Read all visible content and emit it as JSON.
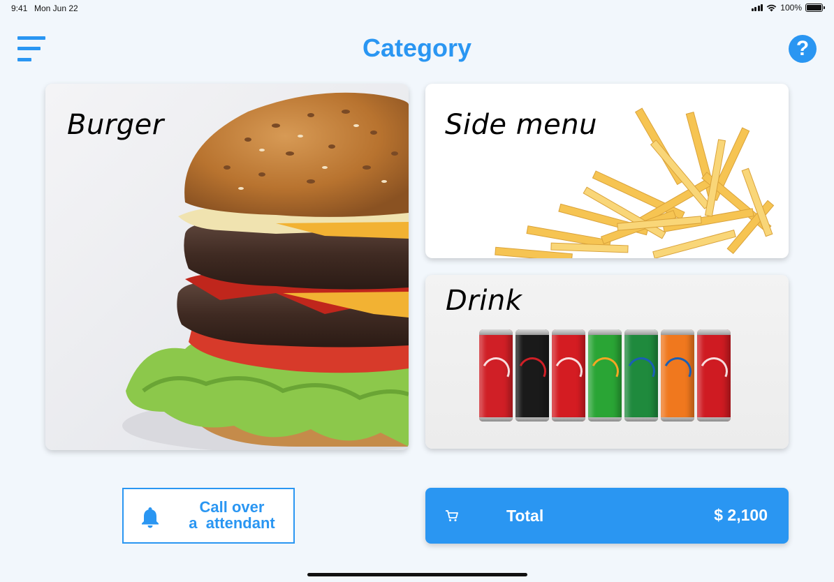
{
  "status_bar": {
    "time": "9:41",
    "date": "Mon Jun 22",
    "battery": "100%",
    "battery_level": 1.0
  },
  "header": {
    "title": "Category",
    "menu_icon": "hamburger-menu-icon",
    "help_icon": "question-mark-icon",
    "help_glyph": "?"
  },
  "categories": [
    {
      "label": "Burger",
      "image": "burger-image"
    },
    {
      "label": "Side menu",
      "image": "french-fries-image"
    },
    {
      "label": "Drink",
      "image": "soda-cans-image"
    }
  ],
  "drink_cans": [
    {
      "color": "#d01f26"
    },
    {
      "color": "#1a1a1a"
    },
    {
      "color": "#d41c22"
    },
    {
      "color": "#2aa535"
    },
    {
      "color": "#1f8a3d"
    },
    {
      "color": "#f0781e"
    },
    {
      "color": "#cf1b22"
    }
  ],
  "attendant_button": {
    "line1": "Call over",
    "line2": "a  attendant",
    "icon": "bell-icon"
  },
  "total_button": {
    "icon": "cart-icon",
    "label": "Total",
    "amount": "$ 2,100"
  },
  "colors": {
    "accent": "#2a96f2",
    "background": "#f2f7fc"
  }
}
